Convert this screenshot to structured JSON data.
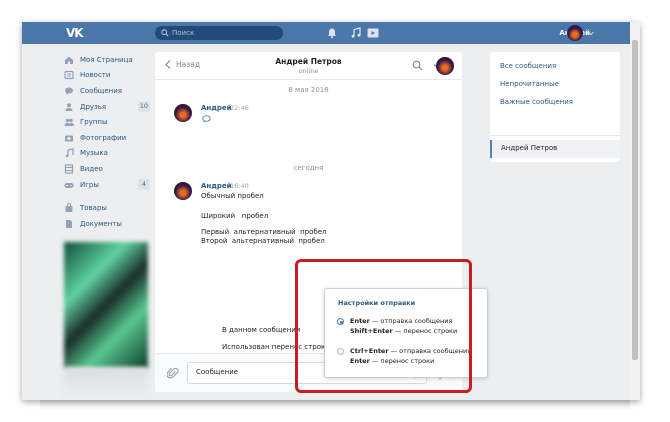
{
  "header": {
    "logo": "VK",
    "search_placeholder": "Поиск",
    "user_name": "Андрей"
  },
  "left_nav": {
    "items": [
      {
        "label": "Моя Страница",
        "icon": "home-icon"
      },
      {
        "label": "Новости",
        "icon": "news-icon"
      },
      {
        "label": "Сообщения",
        "icon": "messages-icon"
      },
      {
        "label": "Друзья",
        "icon": "friends-icon",
        "badge": "10"
      },
      {
        "label": "Группы",
        "icon": "groups-icon"
      },
      {
        "label": "Фотографии",
        "icon": "camera-icon"
      },
      {
        "label": "Музыка",
        "icon": "music-icon"
      },
      {
        "label": "Видео",
        "icon": "video-icon"
      },
      {
        "label": "Игры",
        "icon": "games-icon",
        "badge": "4"
      },
      {
        "label": "Товары",
        "icon": "bag-icon"
      },
      {
        "label": "Документы",
        "icon": "doc-icon"
      }
    ]
  },
  "chat": {
    "back_label": "Назад",
    "contact_name": "Андрей Петров",
    "contact_status": "online",
    "date_1": "8 мая 2018",
    "date_2": "сегодня",
    "msg1_author": "Андрей",
    "msg1_time": "22:46",
    "msg2_author": "Андрей",
    "msg2_time": "16:40",
    "msg2_lines": {
      "l1": "Обычный пробел",
      "l2": "Широкий   пробел",
      "l3": "Первый  альтернативный  пробел",
      "l4": "Второй  альтернативный  пробел"
    },
    "msg3_line1": "В данном сообщении",
    "msg3_line2": "Использован перенос строки",
    "composer_placeholder": "Сообщение"
  },
  "send_settings": {
    "title": "Настройки отправки",
    "option1": {
      "key1": "Enter",
      "text1": " — отправка сообщения",
      "key2": "Shift+Enter",
      "text2": " — перенос строки",
      "selected": true
    },
    "option2": {
      "key1": "Ctrl+Enter",
      "text1": " — отправка сообщения",
      "key2": "Enter",
      "text2": " — перенос строки",
      "selected": false
    }
  },
  "right_nav": {
    "all": "Все сообщения",
    "unread": "Непрочитанные",
    "important": "Важные сообщения",
    "active": "Андрей Петров"
  },
  "colors": {
    "brand": "#4a76a8",
    "highlight": "#c81e1e",
    "link": "#2a5885"
  }
}
